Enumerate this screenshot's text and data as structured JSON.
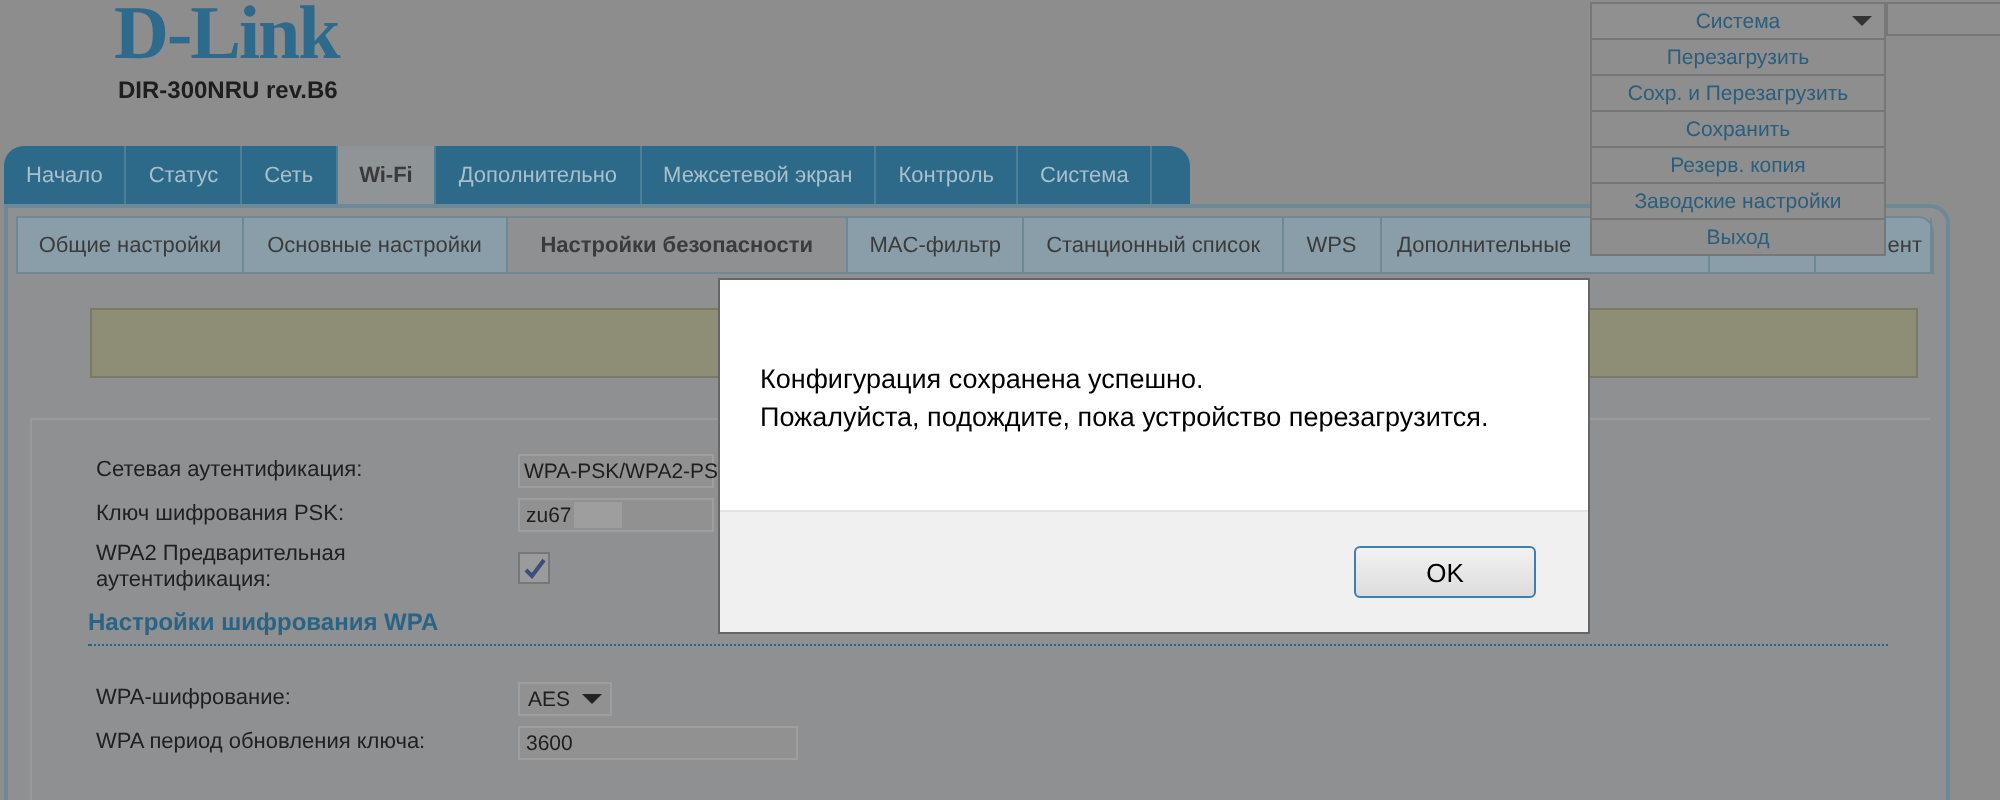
{
  "logo": {
    "brand": "D-Link",
    "model": "DIR-300NRU rev.B6"
  },
  "main_tabs": [
    {
      "label": "Начало",
      "selected": false
    },
    {
      "label": "Статус",
      "selected": false
    },
    {
      "label": "Сеть",
      "selected": false
    },
    {
      "label": "Wi-Fi",
      "selected": true
    },
    {
      "label": "Дополнительно",
      "selected": false
    },
    {
      "label": "Межсетевой экран",
      "selected": false
    },
    {
      "label": "Контроль",
      "selected": false
    },
    {
      "label": "Система",
      "selected": false
    }
  ],
  "sub_tabs": [
    {
      "label": "Общие настройки",
      "selected": false
    },
    {
      "label": "Основные настройки",
      "selected": false
    },
    {
      "label": "Настройки безопасности",
      "selected": true
    },
    {
      "label": "MAC-фильтр",
      "selected": false
    },
    {
      "label": "Станционный список",
      "selected": false
    },
    {
      "label": "WPS",
      "selected": false
    },
    {
      "label": "Дополнительные",
      "selected": false
    },
    {
      "selected": false
    },
    {
      "label": "ент",
      "selected": false
    }
  ],
  "form": {
    "sections": [
      {
        "fields": [
          {
            "kind": "select",
            "label": "Сетевая аутентификация:",
            "value": "WPA-PSK/WPA2-PS"
          },
          {
            "kind": "text",
            "label": "Ключ шифрования PSK:",
            "value": "zu67",
            "redacted": true
          },
          {
            "kind": "checkbox",
            "label": "WPA2 Предварительная аутентификация:",
            "checked": true
          }
        ]
      },
      {
        "title": "Настройки шифрования WPA",
        "fields": [
          {
            "kind": "select",
            "label": "WPA-шифрование:",
            "value": "AES"
          },
          {
            "kind": "text",
            "label": "WPA период обновления ключа:",
            "value": "3600"
          }
        ]
      }
    ]
  },
  "system_menu": {
    "title": "Система",
    "items": [
      "Перезагрузить",
      "Сохр. и Перезагрузить",
      "Сохранить",
      "Резерв. копия",
      "Заводские настройки",
      "Выход"
    ]
  },
  "dialog": {
    "lines": [
      "Конфигурация сохранена успешно.",
      "Пожалуйста, подождите, пока устройство перезагрузится."
    ],
    "button": "OK"
  }
}
